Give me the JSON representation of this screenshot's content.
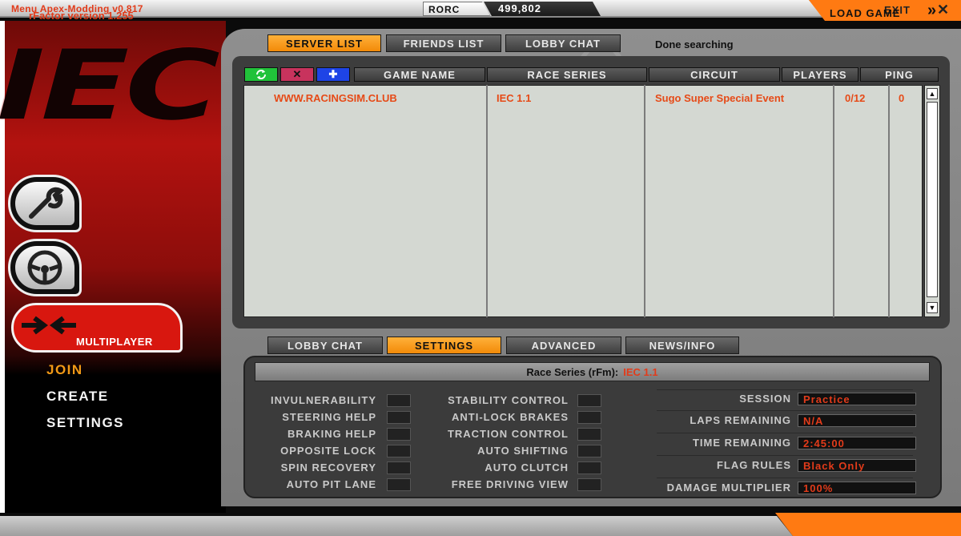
{
  "window": {
    "title": "Menu Apex-Modding v0.817",
    "rorc_label": "RORC",
    "rorc_value": "499,802",
    "exit_label": "EXIT",
    "close_icon": "close-icon"
  },
  "left_menu": {
    "logo_text": "IEC",
    "multiplayer_label": "MULTIPLAYER",
    "submenu": [
      "JOIN",
      "CREATE",
      "SETTINGS"
    ],
    "active_submenu": "JOIN"
  },
  "top_tabs": [
    {
      "label": "SERVER LIST",
      "active": true
    },
    {
      "label": "FRIENDS LIST",
      "active": false
    },
    {
      "label": "LOBBY CHAT",
      "active": false
    }
  ],
  "status_text": "Done searching",
  "server_list": {
    "columns": [
      "GAME NAME",
      "RACE SERIES",
      "CIRCUIT",
      "PLAYERS",
      "PING"
    ],
    "rows": [
      {
        "game_name": "WWW.RACINGSIM.CLUB",
        "race_series": "IEC 1.1",
        "circuit": "Sugo Super Special Event",
        "players": "0/12",
        "ping": "0"
      }
    ]
  },
  "bottom_tabs": [
    {
      "label": "LOBBY CHAT",
      "active": false
    },
    {
      "label": "SETTINGS",
      "active": true
    },
    {
      "label": "ADVANCED",
      "active": false
    },
    {
      "label": "NEWS/INFO",
      "active": false
    }
  ],
  "settings": {
    "race_series_label": "Race Series (rFm):",
    "race_series_value": "IEC 1.1",
    "aids_left": [
      "INVULNERABILITY",
      "STEERING HELP",
      "BRAKING HELP",
      "OPPOSITE LOCK",
      "SPIN RECOVERY",
      "AUTO PIT LANE"
    ],
    "aids_right": [
      "STABILITY CONTROL",
      "ANTI-LOCK BRAKES",
      "TRACTION CONTROL",
      "AUTO SHIFTING",
      "AUTO CLUTCH",
      "FREE DRIVING VIEW"
    ],
    "session": [
      {
        "label": "SESSION",
        "value": "Practice"
      },
      {
        "label": "LAPS REMAINING",
        "value": "N/A"
      },
      {
        "label": "TIME REMAINING",
        "value": "2:45:00"
      },
      {
        "label": "FLAG RULES",
        "value": "Black Only"
      },
      {
        "label": "DAMAGE MULTIPLIER",
        "value": "100%"
      }
    ]
  },
  "footer": {
    "version": "rFactor version  1.255",
    "load_game_label": "LOAD GAME"
  },
  "colors": {
    "accent_orange": "#ff7a12",
    "highlight_red": "#e23b1a",
    "active_tab": "#f59a1c"
  }
}
